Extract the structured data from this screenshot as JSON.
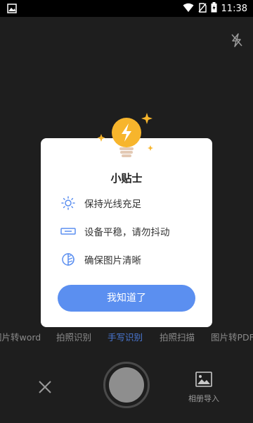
{
  "status_bar": {
    "time": "11:38"
  },
  "tips": {
    "title": "小贴士",
    "items": [
      {
        "icon": "sun-icon",
        "label": "保持光线充足"
      },
      {
        "icon": "level-icon",
        "label": "设备平稳，请勿抖动"
      },
      {
        "icon": "contrast-icon",
        "label": "确保图片清晰"
      }
    ],
    "ok_label": "我知道了"
  },
  "modes": [
    {
      "label": "图片转word",
      "active": false
    },
    {
      "label": "拍照识别",
      "active": false
    },
    {
      "label": "手写识别",
      "active": true
    },
    {
      "label": "拍照扫描",
      "active": false
    },
    {
      "label": "图片转PDF",
      "active": false
    }
  ],
  "bottom": {
    "album_label": "相册导入"
  },
  "colors": {
    "accent": "#5b8ff0",
    "active_mode": "#4a78d6",
    "bulb": "#f7b52c"
  }
}
